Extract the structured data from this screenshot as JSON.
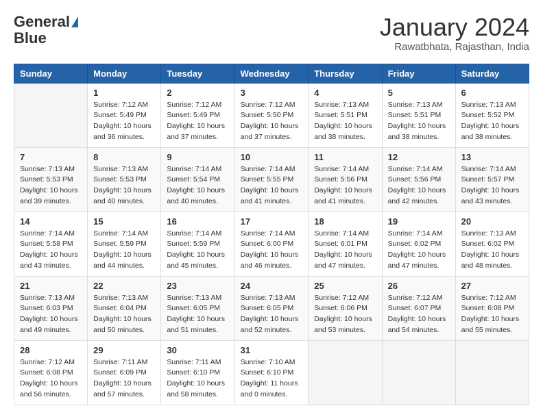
{
  "header": {
    "logo_line1": "General",
    "logo_line2": "Blue",
    "month_title": "January 2024",
    "subtitle": "Rawatbhata, Rajasthan, India"
  },
  "calendar": {
    "days_of_week": [
      "Sunday",
      "Monday",
      "Tuesday",
      "Wednesday",
      "Thursday",
      "Friday",
      "Saturday"
    ],
    "weeks": [
      [
        {
          "day": "",
          "info": ""
        },
        {
          "day": "1",
          "info": "Sunrise: 7:12 AM\nSunset: 5:49 PM\nDaylight: 10 hours\nand 36 minutes."
        },
        {
          "day": "2",
          "info": "Sunrise: 7:12 AM\nSunset: 5:49 PM\nDaylight: 10 hours\nand 37 minutes."
        },
        {
          "day": "3",
          "info": "Sunrise: 7:12 AM\nSunset: 5:50 PM\nDaylight: 10 hours\nand 37 minutes."
        },
        {
          "day": "4",
          "info": "Sunrise: 7:13 AM\nSunset: 5:51 PM\nDaylight: 10 hours\nand 38 minutes."
        },
        {
          "day": "5",
          "info": "Sunrise: 7:13 AM\nSunset: 5:51 PM\nDaylight: 10 hours\nand 38 minutes."
        },
        {
          "day": "6",
          "info": "Sunrise: 7:13 AM\nSunset: 5:52 PM\nDaylight: 10 hours\nand 38 minutes."
        }
      ],
      [
        {
          "day": "7",
          "info": "Sunrise: 7:13 AM\nSunset: 5:53 PM\nDaylight: 10 hours\nand 39 minutes."
        },
        {
          "day": "8",
          "info": "Sunrise: 7:13 AM\nSunset: 5:53 PM\nDaylight: 10 hours\nand 40 minutes."
        },
        {
          "day": "9",
          "info": "Sunrise: 7:14 AM\nSunset: 5:54 PM\nDaylight: 10 hours\nand 40 minutes."
        },
        {
          "day": "10",
          "info": "Sunrise: 7:14 AM\nSunset: 5:55 PM\nDaylight: 10 hours\nand 41 minutes."
        },
        {
          "day": "11",
          "info": "Sunrise: 7:14 AM\nSunset: 5:56 PM\nDaylight: 10 hours\nand 41 minutes."
        },
        {
          "day": "12",
          "info": "Sunrise: 7:14 AM\nSunset: 5:56 PM\nDaylight: 10 hours\nand 42 minutes."
        },
        {
          "day": "13",
          "info": "Sunrise: 7:14 AM\nSunset: 5:57 PM\nDaylight: 10 hours\nand 43 minutes."
        }
      ],
      [
        {
          "day": "14",
          "info": "Sunrise: 7:14 AM\nSunset: 5:58 PM\nDaylight: 10 hours\nand 43 minutes."
        },
        {
          "day": "15",
          "info": "Sunrise: 7:14 AM\nSunset: 5:59 PM\nDaylight: 10 hours\nand 44 minutes."
        },
        {
          "day": "16",
          "info": "Sunrise: 7:14 AM\nSunset: 5:59 PM\nDaylight: 10 hours\nand 45 minutes."
        },
        {
          "day": "17",
          "info": "Sunrise: 7:14 AM\nSunset: 6:00 PM\nDaylight: 10 hours\nand 46 minutes."
        },
        {
          "day": "18",
          "info": "Sunrise: 7:14 AM\nSunset: 6:01 PM\nDaylight: 10 hours\nand 47 minutes."
        },
        {
          "day": "19",
          "info": "Sunrise: 7:14 AM\nSunset: 6:02 PM\nDaylight: 10 hours\nand 47 minutes."
        },
        {
          "day": "20",
          "info": "Sunrise: 7:13 AM\nSunset: 6:02 PM\nDaylight: 10 hours\nand 48 minutes."
        }
      ],
      [
        {
          "day": "21",
          "info": "Sunrise: 7:13 AM\nSunset: 6:03 PM\nDaylight: 10 hours\nand 49 minutes."
        },
        {
          "day": "22",
          "info": "Sunrise: 7:13 AM\nSunset: 6:04 PM\nDaylight: 10 hours\nand 50 minutes."
        },
        {
          "day": "23",
          "info": "Sunrise: 7:13 AM\nSunset: 6:05 PM\nDaylight: 10 hours\nand 51 minutes."
        },
        {
          "day": "24",
          "info": "Sunrise: 7:13 AM\nSunset: 6:05 PM\nDaylight: 10 hours\nand 52 minutes."
        },
        {
          "day": "25",
          "info": "Sunrise: 7:12 AM\nSunset: 6:06 PM\nDaylight: 10 hours\nand 53 minutes."
        },
        {
          "day": "26",
          "info": "Sunrise: 7:12 AM\nSunset: 6:07 PM\nDaylight: 10 hours\nand 54 minutes."
        },
        {
          "day": "27",
          "info": "Sunrise: 7:12 AM\nSunset: 6:08 PM\nDaylight: 10 hours\nand 55 minutes."
        }
      ],
      [
        {
          "day": "28",
          "info": "Sunrise: 7:12 AM\nSunset: 6:08 PM\nDaylight: 10 hours\nand 56 minutes."
        },
        {
          "day": "29",
          "info": "Sunrise: 7:11 AM\nSunset: 6:09 PM\nDaylight: 10 hours\nand 57 minutes."
        },
        {
          "day": "30",
          "info": "Sunrise: 7:11 AM\nSunset: 6:10 PM\nDaylight: 10 hours\nand 58 minutes."
        },
        {
          "day": "31",
          "info": "Sunrise: 7:10 AM\nSunset: 6:10 PM\nDaylight: 11 hours\nand 0 minutes."
        },
        {
          "day": "",
          "info": ""
        },
        {
          "day": "",
          "info": ""
        },
        {
          "day": "",
          "info": ""
        }
      ]
    ]
  }
}
